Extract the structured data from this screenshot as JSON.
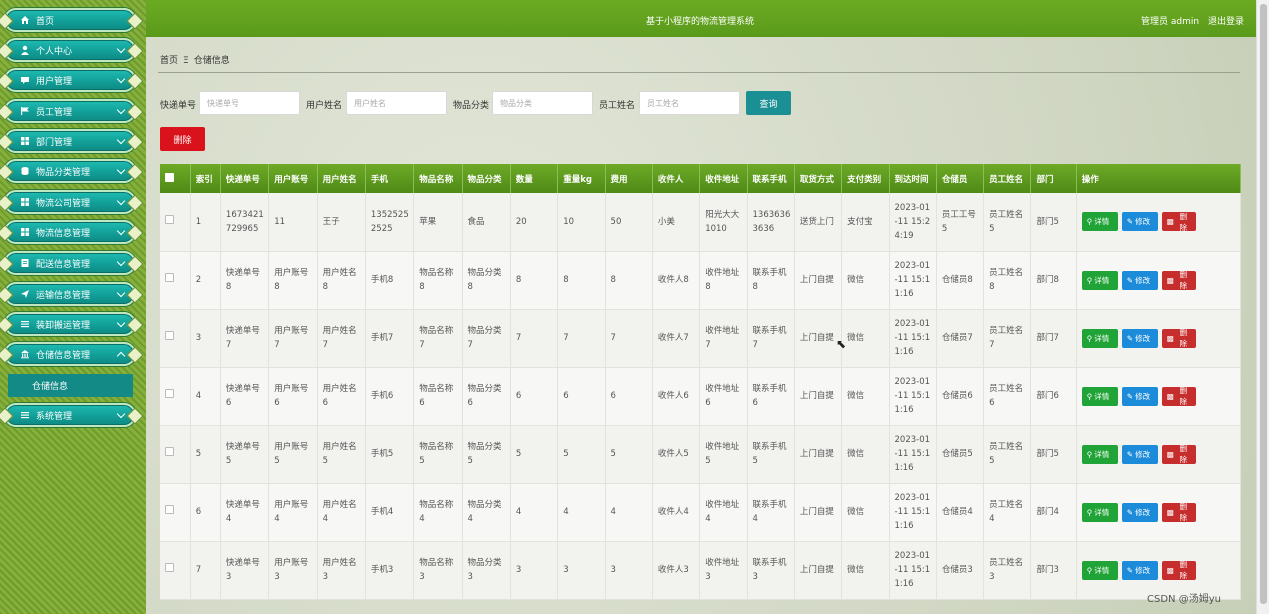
{
  "header": {
    "title": "基于小程序的物流管理系统",
    "user_label": "管理员 admin",
    "logout_label": "退出登录"
  },
  "sidebar": {
    "items": [
      {
        "label": "首页",
        "icon": "home-icon"
      },
      {
        "label": "个人中心",
        "icon": "user-icon"
      },
      {
        "label": "用户管理",
        "icon": "chat-icon"
      },
      {
        "label": "员工管理",
        "icon": "flag-icon"
      },
      {
        "label": "部门管理",
        "icon": "grid-icon"
      },
      {
        "label": "物品分类管理",
        "icon": "database-icon"
      },
      {
        "label": "物流公司管理",
        "icon": "grid-icon"
      },
      {
        "label": "物流信息管理",
        "icon": "grid-icon"
      },
      {
        "label": "配送信息管理",
        "icon": "document-icon"
      },
      {
        "label": "运输信息管理",
        "icon": "send-icon"
      },
      {
        "label": "装卸搬运管理",
        "icon": "list-icon"
      },
      {
        "label": "仓储信息管理",
        "icon": "bank-icon"
      },
      {
        "label": "系统管理",
        "icon": "list-icon"
      }
    ],
    "submenu_label": "仓储信息"
  },
  "breadcrumb": {
    "home": "首页",
    "sep": "Ξ",
    "current": "仓储信息"
  },
  "search": {
    "fields": [
      {
        "label": "快递单号",
        "placeholder": "快递单号"
      },
      {
        "label": "用户姓名",
        "placeholder": "用户姓名"
      },
      {
        "label": "物品分类",
        "placeholder": "物品分类"
      },
      {
        "label": "员工姓名",
        "placeholder": "员工姓名"
      }
    ],
    "query_label": "查询"
  },
  "toolbar": {
    "delete_label": "删除"
  },
  "table": {
    "headers": [
      "索引",
      "快递单号",
      "用户账号",
      "用户姓名",
      "手机",
      "物品名称",
      "物品分类",
      "数量",
      "重量kg",
      "费用",
      "收件人",
      "收件地址",
      "联系手机",
      "取货方式",
      "支付类别",
      "到达时间",
      "仓储员",
      "员工姓名",
      "部门",
      "操作"
    ],
    "rows": [
      [
        "1",
        "1673421\n729965",
        "11",
        "王子",
        "1352525\n2525",
        "苹果",
        "食品",
        "20",
        "10",
        "50",
        "小美",
        "阳光大大\n1010",
        "1363636\n3636",
        "送货上门",
        "支付宝",
        "2023-01\n-11 15:2\n4:19",
        "员工工号\n5",
        "员工姓名\n5",
        "部门5"
      ],
      [
        "2",
        "快递单号\n8",
        "用户账号\n8",
        "用户姓名\n8",
        "手机8",
        "物品名称\n8",
        "物品分类\n8",
        "8",
        "8",
        "8",
        "收件人8",
        "收件地址\n8",
        "联系手机\n8",
        "上门自提",
        "微信",
        "2023-01\n-11 15:1\n1:16",
        "仓储员8",
        "员工姓名\n8",
        "部门8"
      ],
      [
        "3",
        "快递单号\n7",
        "用户账号\n7",
        "用户姓名\n7",
        "手机7",
        "物品名称\n7",
        "物品分类\n7",
        "7",
        "7",
        "7",
        "收件人7",
        "收件地址\n7",
        "联系手机\n7",
        "上门自提",
        "微信",
        "2023-01\n-11 15:1\n1:16",
        "仓储员7",
        "员工姓名\n7",
        "部门7"
      ],
      [
        "4",
        "快递单号\n6",
        "用户账号\n6",
        "用户姓名\n6",
        "手机6",
        "物品名称\n6",
        "物品分类\n6",
        "6",
        "6",
        "6",
        "收件人6",
        "收件地址\n6",
        "联系手机\n6",
        "上门自提",
        "微信",
        "2023-01\n-11 15:1\n1:16",
        "仓储员6",
        "员工姓名\n6",
        "部门6"
      ],
      [
        "5",
        "快递单号\n5",
        "用户账号\n5",
        "用户姓名\n5",
        "手机5",
        "物品名称\n5",
        "物品分类\n5",
        "5",
        "5",
        "5",
        "收件人5",
        "收件地址\n5",
        "联系手机\n5",
        "上门自提",
        "微信",
        "2023-01\n-11 15:1\n1:16",
        "仓储员5",
        "员工姓名\n5",
        "部门5"
      ],
      [
        "6",
        "快递单号\n4",
        "用户账号\n4",
        "用户姓名\n4",
        "手机4",
        "物品名称\n4",
        "物品分类\n4",
        "4",
        "4",
        "4",
        "收件人4",
        "收件地址\n4",
        "联系手机\n4",
        "上门自提",
        "微信",
        "2023-01\n-11 15:1\n1:16",
        "仓储员4",
        "员工姓名\n4",
        "部门4"
      ],
      [
        "7",
        "快递单号\n3",
        "用户账号\n3",
        "用户姓名\n3",
        "手机3",
        "物品名称\n3",
        "物品分类\n3",
        "3",
        "3",
        "3",
        "收件人3",
        "收件地址\n3",
        "联系手机\n3",
        "上门自提",
        "微信",
        "2023-01\n-11 15:1\n1:16",
        "仓储员3",
        "员工姓名\n3",
        "部门3"
      ]
    ],
    "actions": {
      "detail": "详情",
      "edit": "修改",
      "delete": "删除"
    }
  },
  "watermark": "CSDN @汤姆yu",
  "colors": {
    "header_green": "#5a9a1b",
    "menu_teal": "#129f98",
    "query_button": "#1a8f94",
    "delete_button": "#d9121b",
    "detail_button": "#21a437",
    "edit_button": "#1c8bd9",
    "row_delete_button": "#c62d2d"
  }
}
